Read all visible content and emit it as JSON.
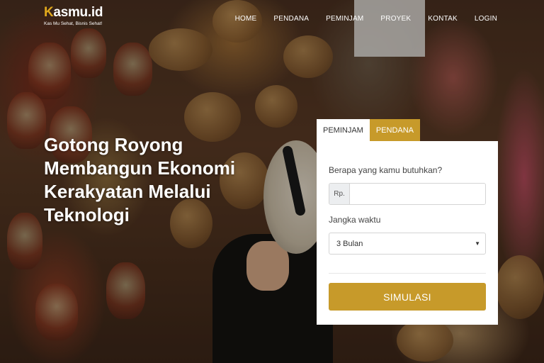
{
  "brand": {
    "logo_text": "Kasmu.id",
    "tagline": "Kas Mu Sehat, Bisnis Sehat!"
  },
  "nav": {
    "items": [
      {
        "label": "HOME"
      },
      {
        "label": "PENDANA"
      },
      {
        "label": "PEMINJAM"
      },
      {
        "label": "PROYEK"
      },
      {
        "label": "KONTAK"
      },
      {
        "label": "LOGIN"
      }
    ]
  },
  "hero": {
    "headline_lines": [
      "Gotong Royong",
      "Membangun Ekonomi",
      "Kerakyatan Melalui",
      "Teknologi"
    ]
  },
  "simulation": {
    "tabs": [
      {
        "label": "PEMINJAM",
        "active": true
      },
      {
        "label": "PENDANA",
        "active": false
      }
    ],
    "amount_label": "Berapa yang kamu butuhkan?",
    "currency_prefix": "Rp.",
    "amount_value": "",
    "duration_label": "Jangka waktu",
    "duration_selected": "3 Bulan",
    "submit_label": "SIMULASI"
  },
  "colors": {
    "accent": "#c79a2a",
    "logo_accent": "#e0a81c"
  }
}
